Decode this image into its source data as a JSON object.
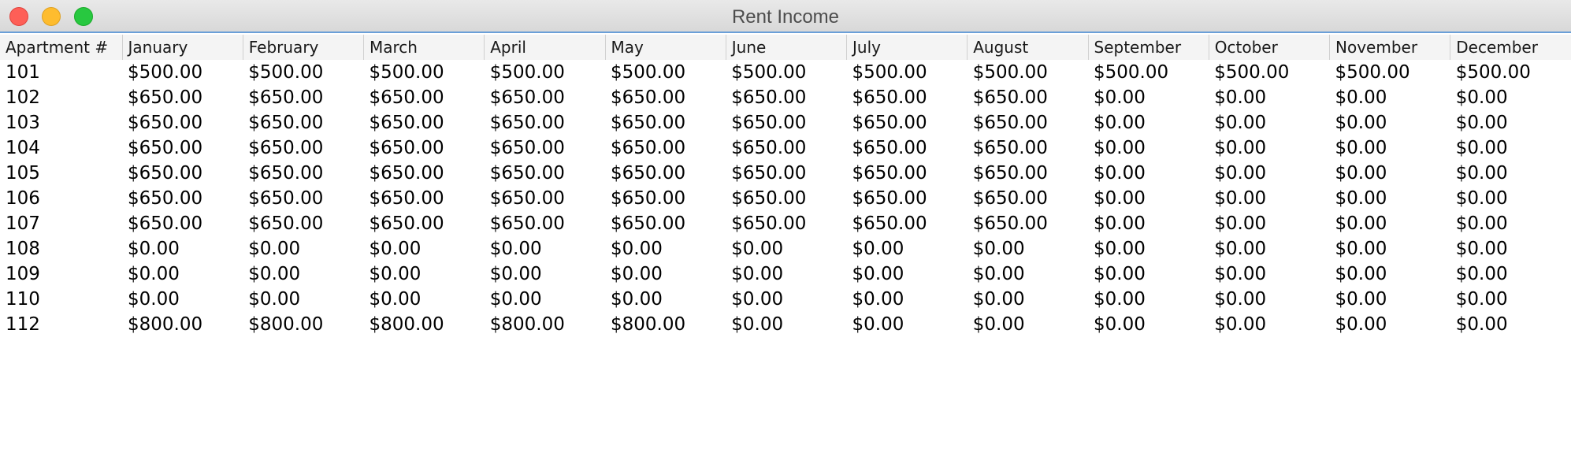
{
  "window": {
    "title": "Rent Income"
  },
  "table": {
    "columns": [
      "Apartment #",
      "January",
      "February",
      "March",
      "April",
      "May",
      "June",
      "July",
      "August",
      "September",
      "October",
      "November",
      "December"
    ],
    "rows": [
      [
        "101",
        "$500.00",
        "$500.00",
        "$500.00",
        "$500.00",
        "$500.00",
        "$500.00",
        "$500.00",
        "$500.00",
        "$500.00",
        "$500.00",
        "$500.00",
        "$500.00"
      ],
      [
        "102",
        "$650.00",
        "$650.00",
        "$650.00",
        "$650.00",
        "$650.00",
        "$650.00",
        "$650.00",
        "$650.00",
        "$0.00",
        "$0.00",
        "$0.00",
        "$0.00"
      ],
      [
        "103",
        "$650.00",
        "$650.00",
        "$650.00",
        "$650.00",
        "$650.00",
        "$650.00",
        "$650.00",
        "$650.00",
        "$0.00",
        "$0.00",
        "$0.00",
        "$0.00"
      ],
      [
        "104",
        "$650.00",
        "$650.00",
        "$650.00",
        "$650.00",
        "$650.00",
        "$650.00",
        "$650.00",
        "$650.00",
        "$0.00",
        "$0.00",
        "$0.00",
        "$0.00"
      ],
      [
        "105",
        "$650.00",
        "$650.00",
        "$650.00",
        "$650.00",
        "$650.00",
        "$650.00",
        "$650.00",
        "$650.00",
        "$0.00",
        "$0.00",
        "$0.00",
        "$0.00"
      ],
      [
        "106",
        "$650.00",
        "$650.00",
        "$650.00",
        "$650.00",
        "$650.00",
        "$650.00",
        "$650.00",
        "$650.00",
        "$0.00",
        "$0.00",
        "$0.00",
        "$0.00"
      ],
      [
        "107",
        "$650.00",
        "$650.00",
        "$650.00",
        "$650.00",
        "$650.00",
        "$650.00",
        "$650.00",
        "$650.00",
        "$0.00",
        "$0.00",
        "$0.00",
        "$0.00"
      ],
      [
        "108",
        "$0.00",
        "$0.00",
        "$0.00",
        "$0.00",
        "$0.00",
        "$0.00",
        "$0.00",
        "$0.00",
        "$0.00",
        "$0.00",
        "$0.00",
        "$0.00"
      ],
      [
        "109",
        "$0.00",
        "$0.00",
        "$0.00",
        "$0.00",
        "$0.00",
        "$0.00",
        "$0.00",
        "$0.00",
        "$0.00",
        "$0.00",
        "$0.00",
        "$0.00"
      ],
      [
        "110",
        "$0.00",
        "$0.00",
        "$0.00",
        "$0.00",
        "$0.00",
        "$0.00",
        "$0.00",
        "$0.00",
        "$0.00",
        "$0.00",
        "$0.00",
        "$0.00"
      ],
      [
        "112",
        "$800.00",
        "$800.00",
        "$800.00",
        "$800.00",
        "$800.00",
        "$0.00",
        "$0.00",
        "$0.00",
        "$0.00",
        "$0.00",
        "$0.00",
        "$0.00"
      ]
    ]
  }
}
